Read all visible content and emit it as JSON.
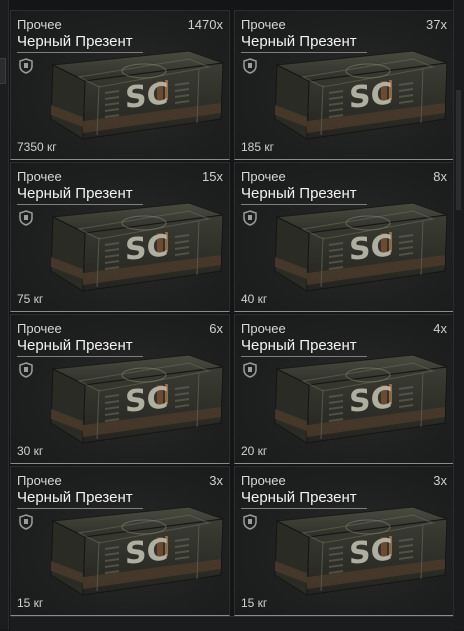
{
  "inventory": {
    "items": [
      {
        "category": "Прочее",
        "name": "Черный Презент",
        "count": "1470x",
        "weight": "7350 кг",
        "image": "black-crate-sc",
        "badge_icon": "shield-icon"
      },
      {
        "category": "Прочее",
        "name": "Черный Презент",
        "count": "37x",
        "weight": "185 кг",
        "image": "black-crate-sc",
        "badge_icon": "shield-icon"
      },
      {
        "category": "Прочее",
        "name": "Черный Презент",
        "count": "15x",
        "weight": "75 кг",
        "image": "black-crate-sc",
        "badge_icon": "shield-icon"
      },
      {
        "category": "Прочее",
        "name": "Черный Презент",
        "count": "8x",
        "weight": "40 кг",
        "image": "black-crate-sc",
        "badge_icon": "shield-icon"
      },
      {
        "category": "Прочее",
        "name": "Черный Презент",
        "count": "6x",
        "weight": "30 кг",
        "image": "black-crate-sc",
        "badge_icon": "shield-icon"
      },
      {
        "category": "Прочее",
        "name": "Черный Презент",
        "count": "4x",
        "weight": "20 кг",
        "image": "black-crate-sc",
        "badge_icon": "shield-icon"
      },
      {
        "category": "Прочее",
        "name": "Черный Презент",
        "count": "3x",
        "weight": "15 кг",
        "image": "black-crate-sc",
        "badge_icon": "shield-icon"
      },
      {
        "category": "Прочее",
        "name": "Черный Презент",
        "count": "3x",
        "weight": "15 кг",
        "image": "black-crate-sc",
        "badge_icon": "shield-icon"
      }
    ],
    "crate_label": "SC"
  },
  "colors": {
    "background": "#141516",
    "card_border_bottom": "#8a8c8e",
    "crate_wood": "#3a3a30",
    "crate_dark": "#1f201c",
    "crate_label": "#bdbcae"
  }
}
